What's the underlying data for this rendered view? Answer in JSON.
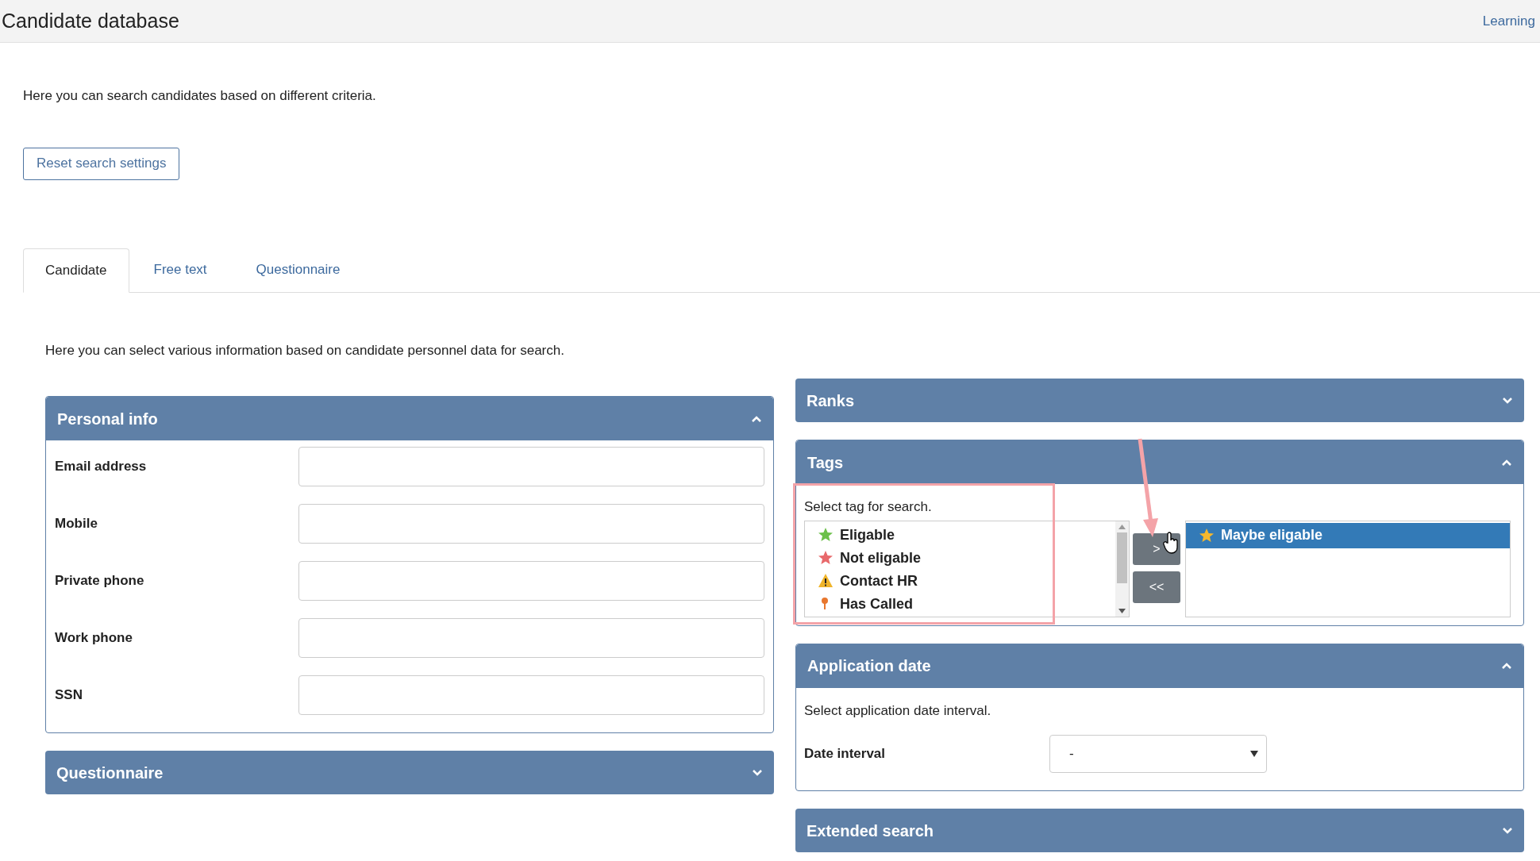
{
  "header": {
    "title": "Candidate database",
    "link": "Learning"
  },
  "intro": "Here you can search candidates based on different criteria.",
  "reset_button": "Reset search settings",
  "tabs": [
    {
      "label": "Candidate",
      "selected": true
    },
    {
      "label": "Free text",
      "selected": false
    },
    {
      "label": "Questionnaire",
      "selected": false
    }
  ],
  "tab_description": "Here you can select various information based on candidate personnel data for search.",
  "personal_info": {
    "title": "Personal info",
    "expanded": true,
    "fields": [
      {
        "label": "Email address"
      },
      {
        "label": "Mobile"
      },
      {
        "label": "Private phone"
      },
      {
        "label": "Work phone"
      },
      {
        "label": "SSN"
      }
    ]
  },
  "questionnaire_panel": {
    "title": "Questionnaire",
    "expanded": false
  },
  "ranks_panel": {
    "title": "Ranks",
    "expanded": false
  },
  "tags_panel": {
    "title": "Tags",
    "expanded": true,
    "hint": "Select tag for search.",
    "available": [
      {
        "label": "Eligable",
        "kind": "star",
        "color": "#6cc04a",
        "selected": false
      },
      {
        "label": "Not eligable",
        "kind": "star",
        "color": "#e8696b",
        "selected": false
      },
      {
        "label": "Contact HR",
        "kind": "warning",
        "color": "#f0b429",
        "selected": false
      },
      {
        "label": "Has Called",
        "kind": "pin",
        "color": "#e8772e",
        "selected": false
      }
    ],
    "add_button": ">",
    "remove_button": "<<",
    "chosen": [
      {
        "label": "Maybe eligable",
        "kind": "star",
        "color": "#f5b82e",
        "selected": true
      }
    ]
  },
  "application_date": {
    "title": "Application date",
    "expanded": true,
    "hint": "Select application date interval.",
    "field_label": "Date interval",
    "value": "-"
  },
  "extended_search": {
    "title": "Extended search",
    "expanded": false
  }
}
